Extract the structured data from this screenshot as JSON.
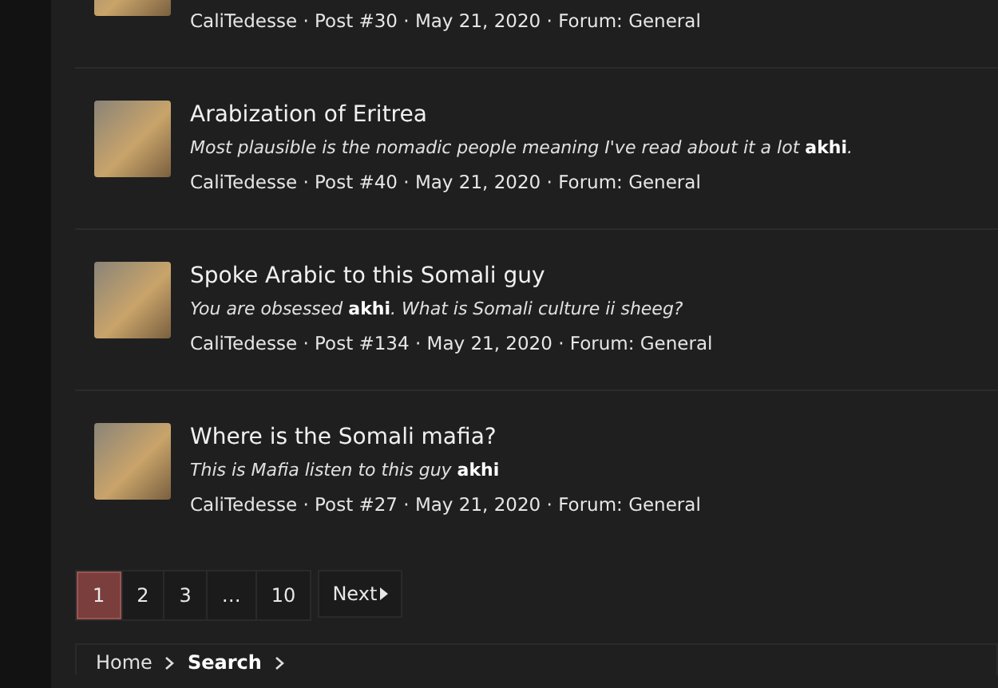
{
  "results": [
    {
      "meta": "CaliTedesse · Post #30 · May 21, 2020 · Forum: General"
    },
    {
      "title": "Arabization of Eritrea",
      "excerpt": "Most plausible is the nomadic people meaning I've read about it a lot **akhi**.",
      "meta": "CaliTedesse · Post #40 · May 21, 2020 · Forum: General"
    },
    {
      "title": "Spoke Arabic to this Somali guy",
      "excerpt": "You are obsessed **akhi**. What is Somali culture ii sheeg?",
      "meta": "CaliTedesse · Post #134 · May 21, 2020 · Forum: General"
    },
    {
      "title": "Where is the Somali mafia?",
      "excerpt": "This is Mafia listen to this guy **akhi**",
      "meta": "CaliTedesse · Post #27 · May 21, 2020 · Forum: General"
    }
  ],
  "pagination": {
    "pages": [
      {
        "label": "1",
        "selected": true
      },
      {
        "label": "2",
        "selected": false
      },
      {
        "label": "3",
        "selected": false
      },
      {
        "label": "…",
        "selected": false
      },
      {
        "label": "10",
        "selected": false
      }
    ],
    "next": "Next"
  },
  "breadcrumb": [
    {
      "label": "Home",
      "current": false
    },
    {
      "label": "Search",
      "current": true
    }
  ]
}
